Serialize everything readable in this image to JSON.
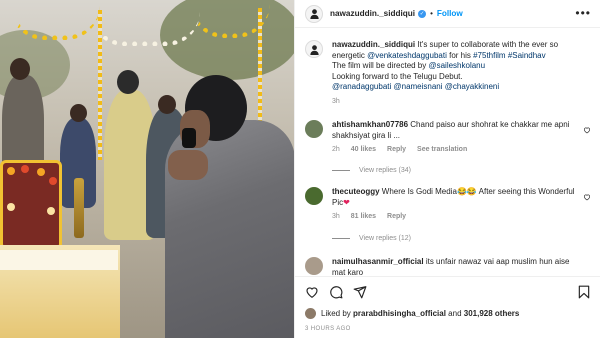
{
  "post": {
    "username": "nawazuddin._siddiqui",
    "follow_label": "Follow",
    "separator": "•",
    "more_label": "•••"
  },
  "caption": {
    "username": "nawazuddin._siddiqui",
    "lead": " It's super to collaborate with the ever so energetic ",
    "mention1": "@venkateshdaggubati",
    "for_his": " for his ",
    "tag1": "#75thfilm",
    "space": " ",
    "tag2": "#Saindhav",
    "line2": "The film will be directed by ",
    "mention2": "@saileshkolanu",
    "line3": "Looking forward to the Telugu Debut.",
    "mentions_line": "@ranadaggubati @nameisnani @chayakkineni",
    "time": "3h"
  },
  "comments": [
    {
      "username": "ahtishamkhan07786",
      "text": " Chand paiso aur shohrat ke chakkar me apni shakhsiyat gira li ...",
      "time": "2h",
      "likes": "40 likes",
      "reply": "Reply",
      "translate": "See translation",
      "view_replies": "View replies (34)"
    },
    {
      "username": "thecuteoggy",
      "text_a": " Where Is Godi Media",
      "emoji_a": "😂😂",
      "text_b": " After seeing this Wonderful Pic",
      "emoji_b": "❤",
      "time": "3h",
      "likes": "81 likes",
      "reply": "Reply",
      "view_replies": "View replies (12)"
    },
    {
      "username": "naimulhasanmir_official",
      "text": " its unfair nawaz vai aap muslim hun aise mat karo"
    }
  ],
  "footer": {
    "liked_by_prefix": "Liked by ",
    "liked_by_user": "prarabdhisingha_official",
    "liked_by_and": " and ",
    "liked_by_count": "301,928 others",
    "time_ago": "3 HOURS AGO"
  },
  "colors": {
    "link": "#00376b",
    "follow": "#0095f6",
    "verified": "#3897f0",
    "meta": "#8e8e8e"
  },
  "icons": [
    "heart-icon",
    "comment-icon",
    "share-icon",
    "bookmark-icon",
    "more-icon",
    "verified-icon"
  ]
}
